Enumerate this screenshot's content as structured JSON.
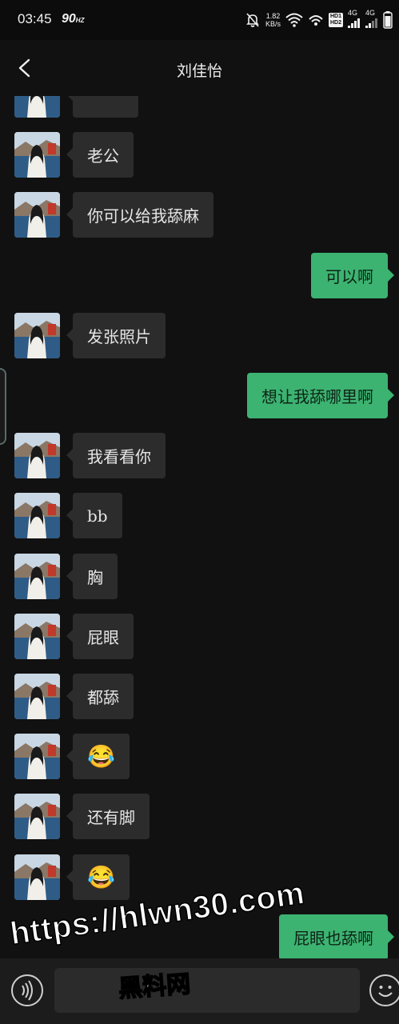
{
  "status_bar": {
    "time": "03:45",
    "refresh_rate": "90",
    "refresh_unit": "HZ",
    "net_speed": "1.82",
    "net_unit": "KB/s",
    "hd_badge": "HD1 HD2",
    "network_type": "4G",
    "network_type_2": "4G",
    "icons": [
      "bell-off-icon",
      "wifi-icon",
      "hotspot-icon",
      "signal-icon",
      "signal-icon-2",
      "battery-icon"
    ]
  },
  "header": {
    "title": "刘佳怡",
    "back_icon": "chevron-left-icon"
  },
  "messages": [
    {
      "side": "in",
      "text": "",
      "partial": true
    },
    {
      "side": "in",
      "text": "老公"
    },
    {
      "side": "in",
      "text": "你可以给我舔麻"
    },
    {
      "side": "out",
      "text": "可以啊"
    },
    {
      "side": "in",
      "text": "发张照片"
    },
    {
      "side": "out",
      "text": "想让我舔哪里啊"
    },
    {
      "side": "in",
      "text": "我看看你"
    },
    {
      "side": "in",
      "text": "bb"
    },
    {
      "side": "in",
      "text": "胸"
    },
    {
      "side": "in",
      "text": "屁眼"
    },
    {
      "side": "in",
      "text": "都舔"
    },
    {
      "side": "in",
      "text": "😂"
    },
    {
      "side": "in",
      "text": "还有脚"
    },
    {
      "side": "in",
      "text": "😂"
    },
    {
      "side": "out",
      "text": "屁眼也舔啊"
    }
  ],
  "input_bar": {
    "voice_icon": "voice-icon",
    "emoji_icon": "smiley-icon",
    "value": ""
  },
  "watermark": {
    "url": "https://hlwn30.com",
    "name": "黑料网"
  },
  "colors": {
    "background": "#111111",
    "incoming_bubble": "#2c2c2c",
    "outgoing_bubble": "#3cb371"
  }
}
